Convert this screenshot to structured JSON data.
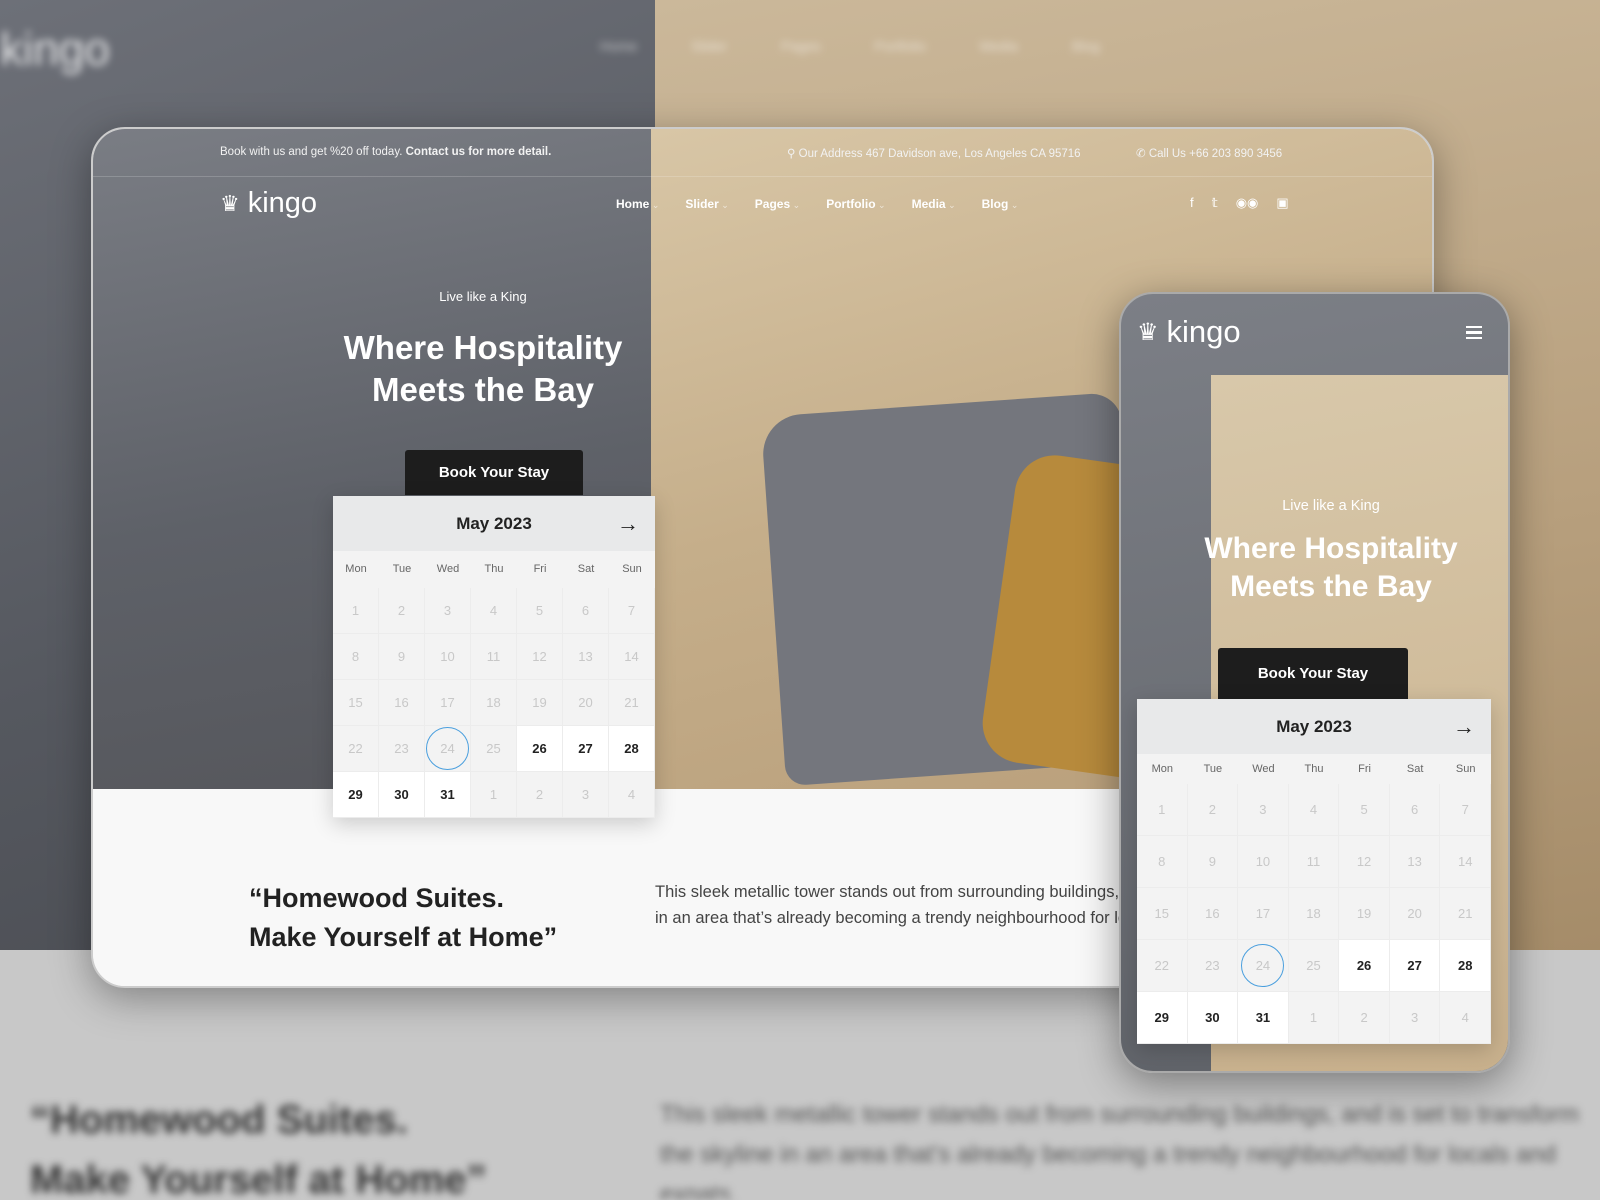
{
  "brand": {
    "name": "kingo",
    "accent": "#4a9fde",
    "dark": "#1d1d1d"
  },
  "topbar": {
    "promo": "Book with us and get %20 off today.",
    "promo_link": "Contact us for more detail.",
    "address": "Our Address 467 Davidson ave, Los Angeles CA 95716",
    "phone": "Call Us +66 203 890 3456"
  },
  "nav": [
    "Home",
    "Slider",
    "Pages",
    "Portfolio",
    "Media",
    "Blog"
  ],
  "social": [
    "facebook-icon",
    "twitter-icon",
    "tripadvisor-icon",
    "instagram-icon"
  ],
  "hero": {
    "tagline": "Live like a King",
    "title_line1": "Where Hospitality",
    "title_line2": "Meets the Bay",
    "cta": "Book Your Stay"
  },
  "calendar": {
    "month": "May 2023",
    "weekdays": [
      "Mon",
      "Tue",
      "Wed",
      "Thu",
      "Fri",
      "Sat",
      "Sun"
    ],
    "days": [
      "1",
      "2",
      "3",
      "4",
      "5",
      "6",
      "7",
      "8",
      "9",
      "10",
      "11",
      "12",
      "13",
      "14",
      "15",
      "16",
      "17",
      "18",
      "19",
      "20",
      "21",
      "22",
      "23",
      "24",
      "25",
      "26",
      "27",
      "28",
      "29",
      "30",
      "31",
      "1",
      "2",
      "3",
      "4"
    ],
    "available": [
      "26",
      "27",
      "28",
      "29",
      "30",
      "31"
    ],
    "today": "24"
  },
  "intro": {
    "quote_line1": "“Homewood Suites.",
    "quote_line2": "Make Yourself at Home”",
    "body": "This sleek metallic tower stands out from surrounding buildings, and is set to transform the skyline in an area that’s already becoming a trendy neighbourhood for locals and expats."
  }
}
